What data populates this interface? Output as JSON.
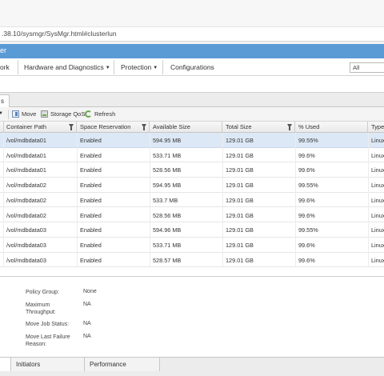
{
  "browser": {
    "url": ".38.10/sysmgr/SysMgr.html#clusterlun"
  },
  "app": {
    "header_title": "er"
  },
  "menu": {
    "items": [
      {
        "label": "ork",
        "has_dropdown": false
      },
      {
        "label": "Hardware and Diagnostics",
        "has_dropdown": true
      },
      {
        "label": "Protection",
        "has_dropdown": true
      },
      {
        "label": "Configurations",
        "has_dropdown": false
      }
    ],
    "search_scope": "All"
  },
  "panel": {
    "tab_label": "s"
  },
  "toolbar": {
    "buttons": [
      {
        "label": "Move",
        "icon": "move-icon"
      },
      {
        "label": "Storage QoS",
        "icon": "storage-qos-icon"
      },
      {
        "label": "Refresh",
        "icon": "refresh-icon"
      }
    ]
  },
  "table": {
    "columns": [
      "Container Path",
      "Space Reservation",
      "Available Size",
      "Total Size",
      "% Used",
      "Type"
    ],
    "rows": [
      {
        "path": "/vol/mdbdata01",
        "reservation": "Enabled",
        "available": "594.95 MB",
        "total": "129.01 GB",
        "used": "99.55%",
        "type": "Linux",
        "selected": true
      },
      {
        "path": "/vol/mdbdata01",
        "reservation": "Enabled",
        "available": "533.71 MB",
        "total": "129.01 GB",
        "used": "99.6%",
        "type": "Linux"
      },
      {
        "path": "/vol/mdbdata01",
        "reservation": "Enabled",
        "available": "528.56 MB",
        "total": "129.01 GB",
        "used": "99.6%",
        "type": "Linux"
      },
      {
        "path": "/vol/mdbdata02",
        "reservation": "Enabled",
        "available": "594.95 MB",
        "total": "129.01 GB",
        "used": "99.55%",
        "type": "Linux"
      },
      {
        "path": "/vol/mdbdata02",
        "reservation": "Enabled",
        "available": "533.7 MB",
        "total": "129.01 GB",
        "used": "99.6%",
        "type": "Linux"
      },
      {
        "path": "/vol/mdbdata02",
        "reservation": "Enabled",
        "available": "528.56 MB",
        "total": "129.01 GB",
        "used": "99.6%",
        "type": "Linux"
      },
      {
        "path": "/vol/mdbdata03",
        "reservation": "Enabled",
        "available": "594.96 MB",
        "total": "129.01 GB",
        "used": "99.55%",
        "type": "Linux"
      },
      {
        "path": "/vol/mdbdata03",
        "reservation": "Enabled",
        "available": "533.71 MB",
        "total": "129.01 GB",
        "used": "99.6%",
        "type": "Linux"
      },
      {
        "path": "/vol/mdbdata03",
        "reservation": "Enabled",
        "available": "528.57 MB",
        "total": "129.01 GB",
        "used": "99.6%",
        "type": "Linux"
      }
    ]
  },
  "details": {
    "policy_group_label": "Policy Group:",
    "policy_group_value": "None",
    "max_throughput_label": "Maximum Throughput:",
    "max_throughput_value": "NA",
    "move_job_status_label": "Move Job Status:",
    "move_job_status_value": "NA",
    "move_last_failure_label": "Move Last Failure Reason:",
    "move_last_failure_value": "NA"
  },
  "bottom_tabs": [
    "Initiators",
    "Performance"
  ],
  "colors": {
    "header_blue": "#5b9bd5",
    "selected_row": "#dde8f6"
  }
}
